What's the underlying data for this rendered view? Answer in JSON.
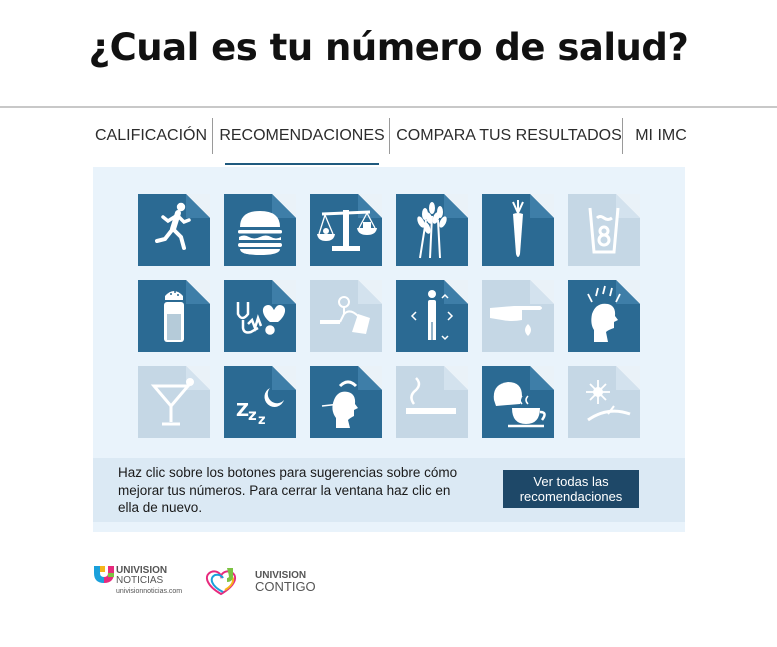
{
  "header": {
    "title": "¿Cual es tu número de salud?"
  },
  "tabs": [
    {
      "label": "CALIFICACIÓN"
    },
    {
      "label": "RECOMENDACIONES"
    },
    {
      "label": "COMPARA TUS RESULTADOS"
    },
    {
      "label": "MI IMC"
    }
  ],
  "active_tab": "RECOMENDACIONES",
  "tiles": [
    {
      "icon": "running-person-icon",
      "active": true
    },
    {
      "icon": "hamburger-icon",
      "active": true
    },
    {
      "icon": "balance-scale-icon",
      "active": true
    },
    {
      "icon": "wheat-grains-icon",
      "active": true
    },
    {
      "icon": "carrot-icon",
      "active": true
    },
    {
      "icon": "water-glass-icon",
      "active": false
    },
    {
      "icon": "salt-shaker-icon",
      "active": true
    },
    {
      "icon": "stethoscope-heart-icon",
      "active": true
    },
    {
      "icon": "blood-pressure-cuff-icon",
      "active": false
    },
    {
      "icon": "body-measure-icon",
      "active": true
    },
    {
      "icon": "finger-prick-icon",
      "active": false
    },
    {
      "icon": "headache-icon",
      "active": true
    },
    {
      "icon": "cocktail-glass-icon",
      "active": false
    },
    {
      "icon": "sleep-zzz-moon-icon",
      "active": true
    },
    {
      "icon": "thermometer-sick-person-icon",
      "active": true
    },
    {
      "icon": "cigarette-icon",
      "active": false
    },
    {
      "icon": "tea-coffee-icon",
      "active": true
    },
    {
      "icon": "sun-hammock-icon",
      "active": false
    }
  ],
  "info": {
    "text": "Haz clic sobre los botones para sugerencias sobre cómo mejorar tus números. Para cerrar la ventana haz clic en ella de nuevo.",
    "button_label": "Ver todas las recomendaciones"
  },
  "logos": {
    "univision_noticias": {
      "line1": "UNIVISION",
      "line2": "NOTICIAS",
      "line3": "univisionnoticias.com"
    },
    "univision_contigo": {
      "line1": "UNIVISION",
      "line2": "CONTIGO"
    }
  },
  "colors": {
    "tile_active": "#2b6a93",
    "tile_fold": "#3e7ea8",
    "tile_inactive": "#c5d7e5",
    "panel_bg": "#e9f3fb",
    "button_bg": "#1e4868"
  }
}
